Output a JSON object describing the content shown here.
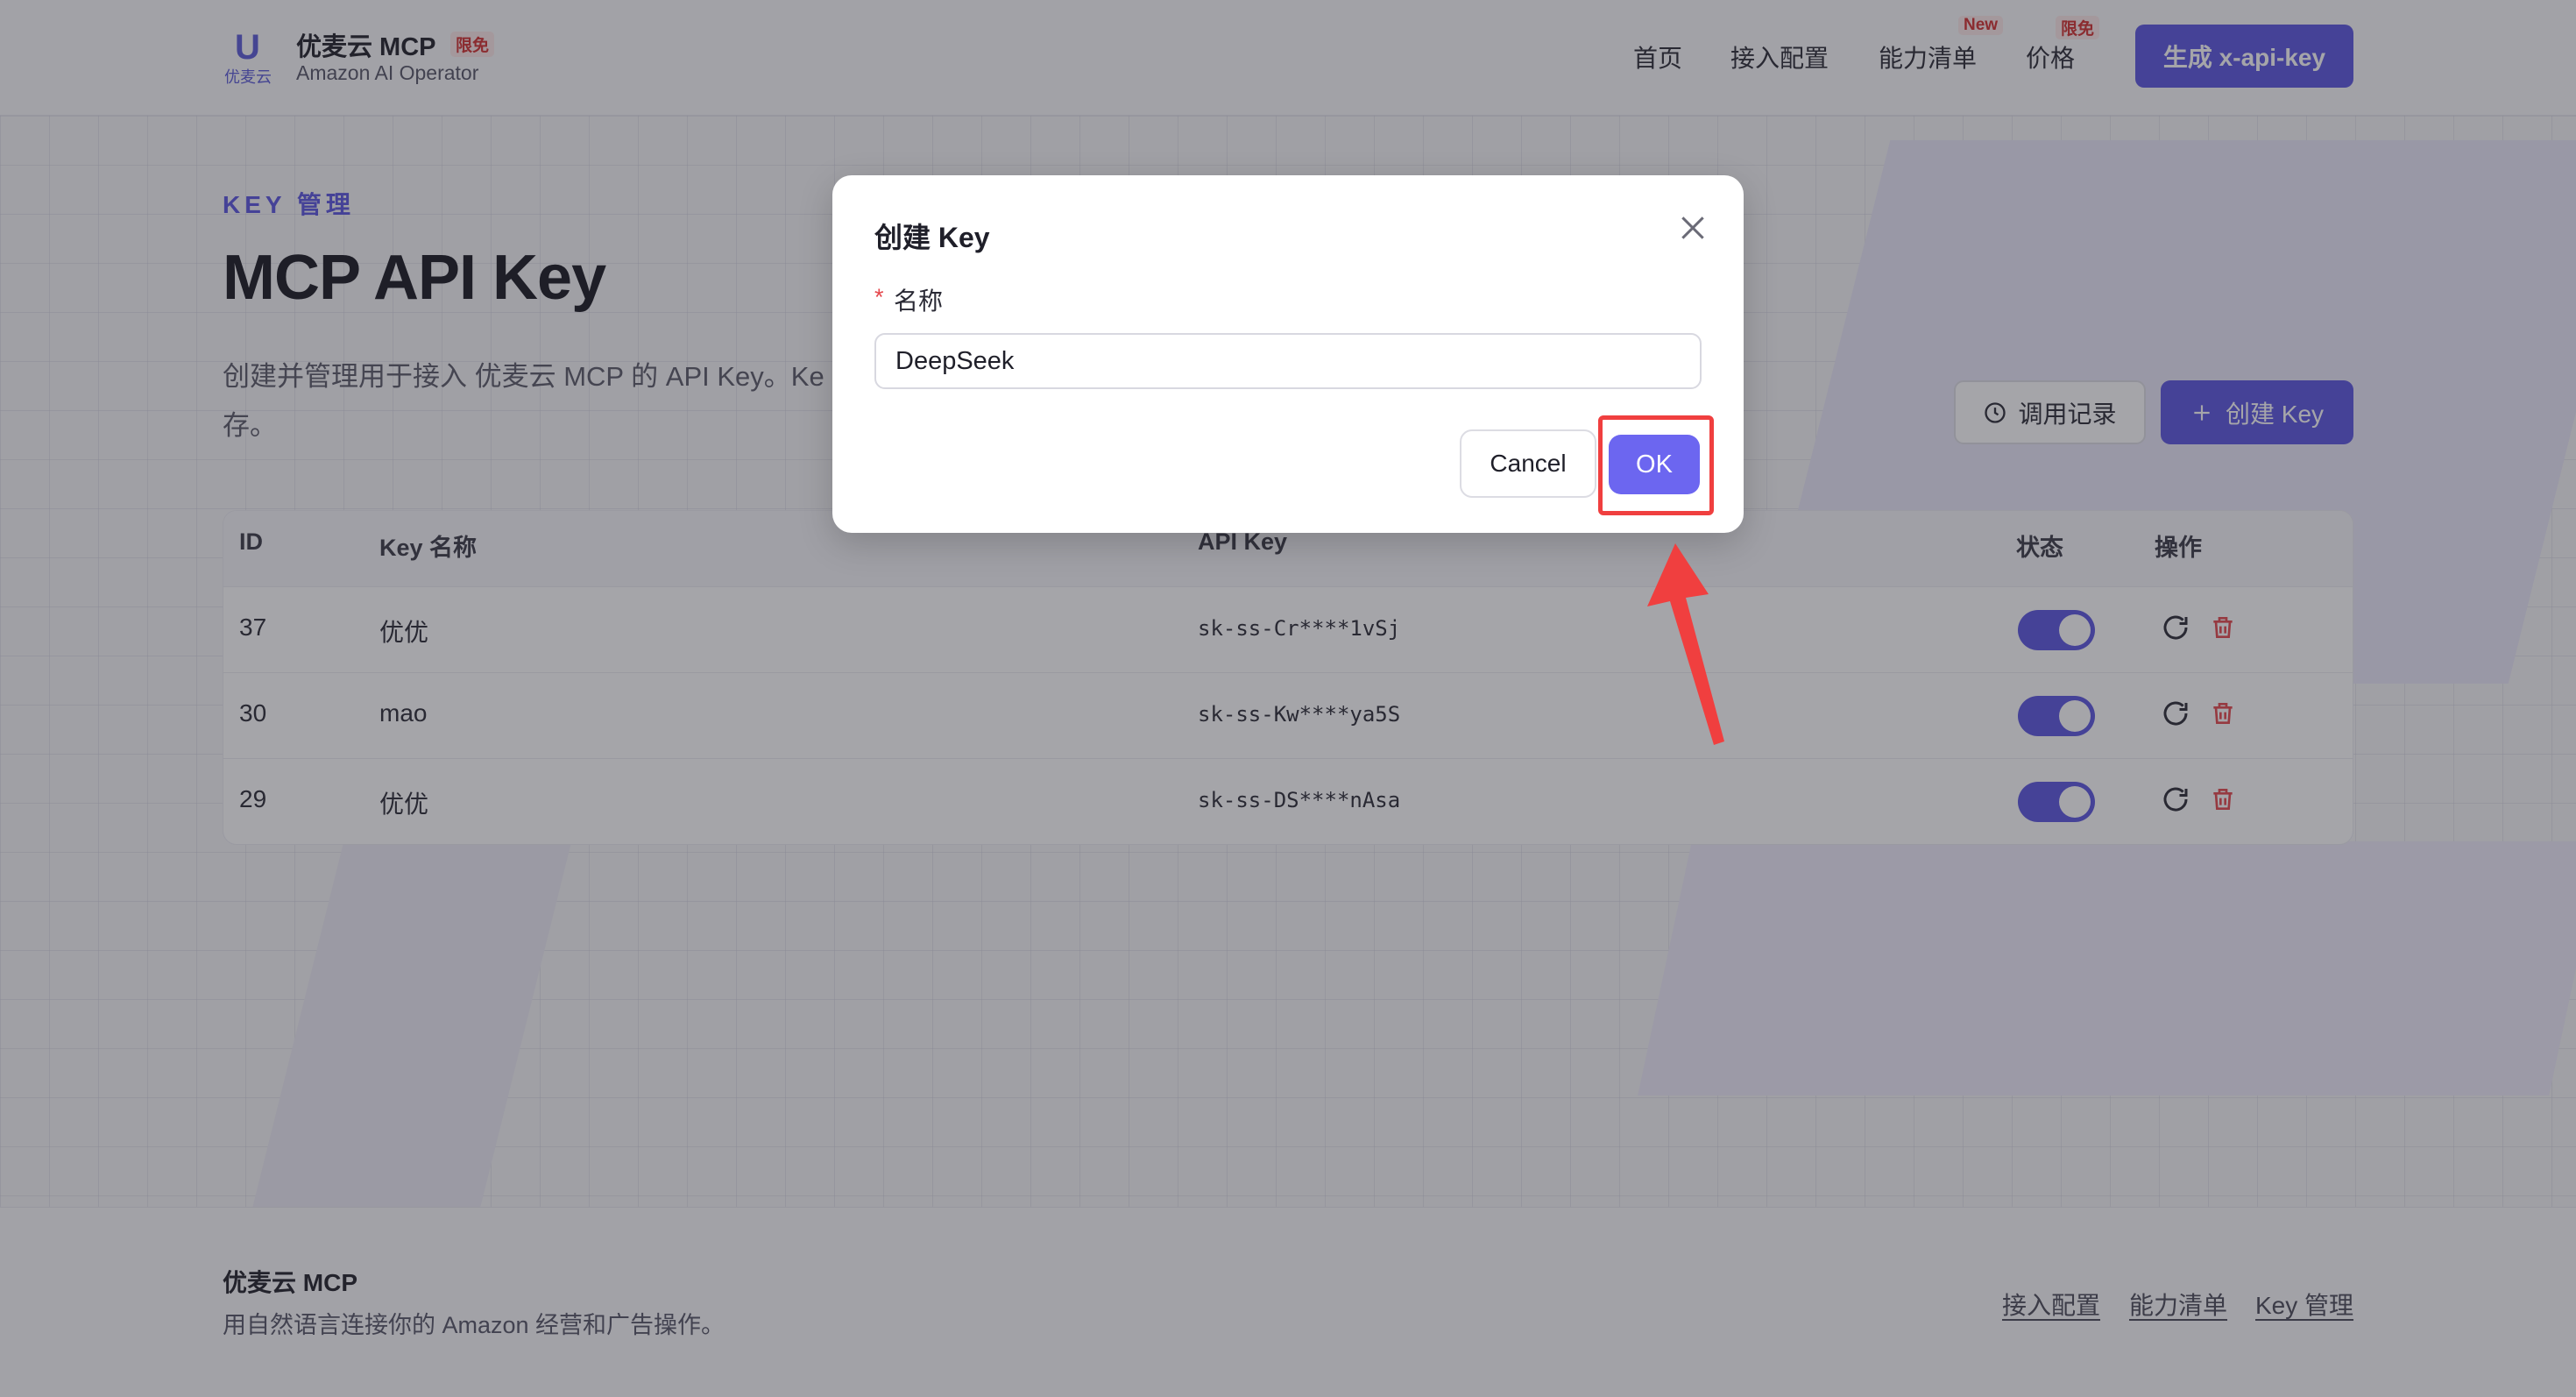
{
  "header": {
    "logo_mark": "U",
    "logo_sub": "优麦云",
    "brand_title": "优麦云 MCP",
    "brand_badge": "限免",
    "brand_subtitle": "Amazon AI Operator",
    "nav": [
      {
        "label": "首页",
        "badge": ""
      },
      {
        "label": "接入配置",
        "badge": ""
      },
      {
        "label": "能力清单",
        "badge": "New"
      },
      {
        "label": "价格",
        "badge": "限免"
      }
    ],
    "cta_label": "生成 x-api-key"
  },
  "main": {
    "eyebrow": "KEY 管理",
    "title": "MCP API Key",
    "description": "创建并管理用于接入 优麦云 MCP 的 API Key。Ke",
    "description_line2": "存。",
    "history_button": "调用记录",
    "create_button": "创建 Key"
  },
  "table": {
    "headers": [
      "ID",
      "Key 名称",
      "API Key",
      "状态",
      "操作"
    ],
    "rows": [
      {
        "id": "37",
        "name": "优优",
        "api_key": "sk-ss-Cr****1vSj",
        "enabled": true
      },
      {
        "id": "30",
        "name": "mao",
        "api_key": "sk-ss-Kw****ya5S",
        "enabled": true
      },
      {
        "id": "29",
        "name": "优优",
        "api_key": "sk-ss-DS****nAsa",
        "enabled": true
      }
    ]
  },
  "footer": {
    "title": "优麦云 MCP",
    "description": "用自然语言连接你的 Amazon 经营和广告操作。",
    "links": [
      "接入配置",
      "能力清单",
      "Key 管理"
    ]
  },
  "modal": {
    "title": "创建 Key",
    "required_mark": "*",
    "field_label": "名称",
    "field_value": "DeepSeek",
    "cancel_label": "Cancel",
    "ok_label": "OK"
  },
  "colors": {
    "accent": "#5b55e0",
    "ok_button": "#6c66f0",
    "annotation_red": "#f03f3f",
    "delete_red": "#e5484d"
  },
  "icons": [
    "close-icon",
    "clock-icon",
    "plus-icon",
    "refresh-icon",
    "trash-icon",
    "annotation-arrow-icon"
  ]
}
